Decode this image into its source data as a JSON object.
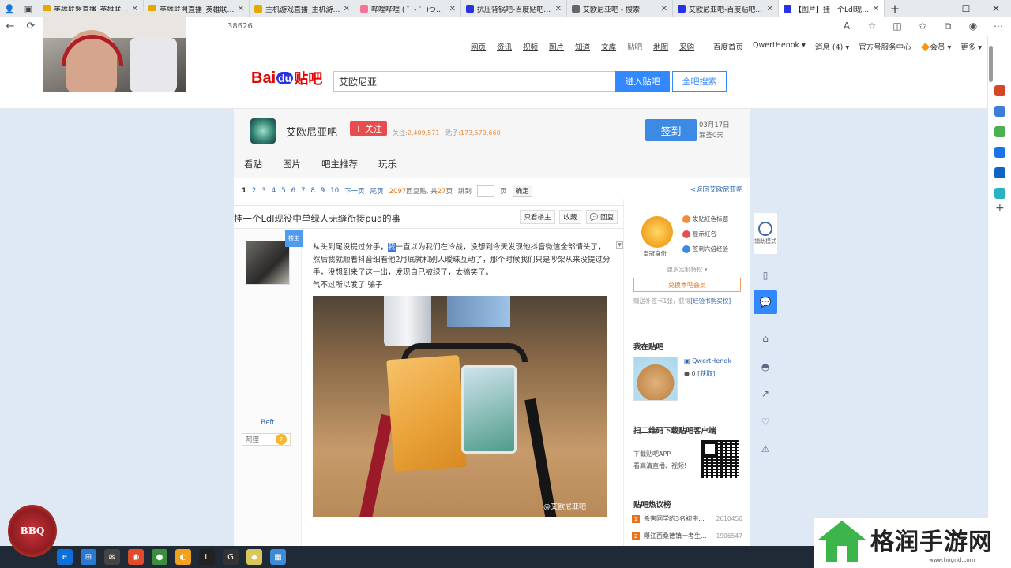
{
  "browser": {
    "tabs": [
      {
        "title": "英雄联盟直播_英雄联盟手",
        "active": false,
        "color": "#e6a700"
      },
      {
        "title": "英雄联盟直播_英雄联盟手",
        "active": false,
        "color": "#e6a700"
      },
      {
        "title": "主机游戏直播_主机游戏直",
        "active": false,
        "color": "#e6a700"
      },
      {
        "title": "哔哩哔哩 ( ゜- ゜)つロ 干杯",
        "active": false,
        "color": "#fb7299"
      },
      {
        "title": "抗压背锅吧-百度贴吧--电",
        "active": false,
        "color": "#2932e1"
      },
      {
        "title": "艾欧尼亚吧 - 搜索",
        "active": false,
        "color": "#666666"
      },
      {
        "title": "艾欧尼亚吧-百度贴吧--艾",
        "active": false,
        "color": "#2932e1"
      },
      {
        "title": "【图片】挂一个Ldl现役中",
        "active": true,
        "color": "#2932e1"
      }
    ],
    "url_fragment": "38626"
  },
  "header": {
    "nav_links": [
      "网页",
      "资讯",
      "视频",
      "图片",
      "知道",
      "文库",
      "贴吧",
      "地图",
      "采购"
    ],
    "right_links": [
      "百度首页",
      "QwertHenok ▾",
      "消息 (4) ▾",
      "官方号服务中心",
      "🔶会员 ▾",
      "更多 ▾"
    ],
    "logo": {
      "bai": "Bai",
      "du": "du",
      "tieba": "贴吧"
    },
    "search_value": "艾欧尼亚",
    "enter_button": "进入贴吧",
    "all_button": "全吧搜索"
  },
  "forum": {
    "name": "艾欧尼亚吧",
    "follow_label": "+ 关注",
    "followers_label": "关注:",
    "followers": "2,409,571",
    "posts_label": "贴子:",
    "posts": "173,570,660",
    "signin_label": "签到",
    "date": "03月17日",
    "streak": "漏签0天",
    "tabs": [
      "看贴",
      "图片",
      "吧主推荐",
      "玩乐"
    ],
    "pager": {
      "pages": [
        "1",
        "2",
        "3",
        "4",
        "5",
        "6",
        "7",
        "8",
        "9",
        "10"
      ],
      "next": "下一页",
      "last": "尾页",
      "reply_count": "2097",
      "reply_text": "回复贴, 共",
      "page_count": "27",
      "page_suffix": "页",
      "jump_label": "跳到",
      "jump_suffix": "页",
      "confirm": "确定"
    },
    "back_link": "<返回艾欧尼亚吧"
  },
  "post": {
    "title": "挂一个Ldl现役中单绿人无缝衔接pua的事",
    "buttons": [
      "只看楼主",
      "收藏",
      "💬 回复"
    ],
    "author": "Beft",
    "badge": "楼主",
    "rank_name": "阿狸",
    "rank_level": "7",
    "body_pre": "从头到尾没提过分手，",
    "body_hl": "我",
    "body_main": "一直以为我们在冷战，没想到今天发现他抖音微信全部情头了，然后我就顺着抖音细看他2月底就和别人暧昧互动了，那个时候我们只是吵架从来没提过分手，没想到来了这一出，发现自己被绿了，太搞笑了。",
    "body_line2": "气不过所以发了 骗子",
    "image_watermark": "@艾欧尼亚吧"
  },
  "sidebar": {
    "vip_label": "皇冠身份",
    "perks": [
      {
        "text": "发贴红色标题",
        "color": "#f08c3c"
      },
      {
        "text": "显示红名",
        "color": "#e84c4c"
      },
      {
        "text": "签到六倍经验",
        "color": "#3d8ae5"
      }
    ],
    "more_perks": "更多定制特权 ▾",
    "redeem": "兑换本吧会员",
    "redeem_note_pre": "赠送补签卡1张，获得",
    "redeem_note_link": "[经验书购买权]",
    "mybar_title": "我在贴吧",
    "mybar_user": "QwertHenok",
    "mybar_coins": "0",
    "mybar_get": "[获取]",
    "app_title": "扫二维码下载贴吧客户端",
    "app_line1": "下载贴吧APP",
    "app_line2": "看高清直播、视频!",
    "hot_title": "贴吧热议榜",
    "hot": [
      {
        "n": "1",
        "title": "杀害同学的3名初中...",
        "count": "2610450"
      },
      {
        "n": "2",
        "title": "曝江西桑德镇一考生...",
        "count": "1906547"
      }
    ]
  },
  "side_tools": {
    "assist_label": "辅助模式"
  },
  "badge": "BBQ",
  "watermark": {
    "name": "格润手游网",
    "url": "www.hngrjd.com"
  }
}
